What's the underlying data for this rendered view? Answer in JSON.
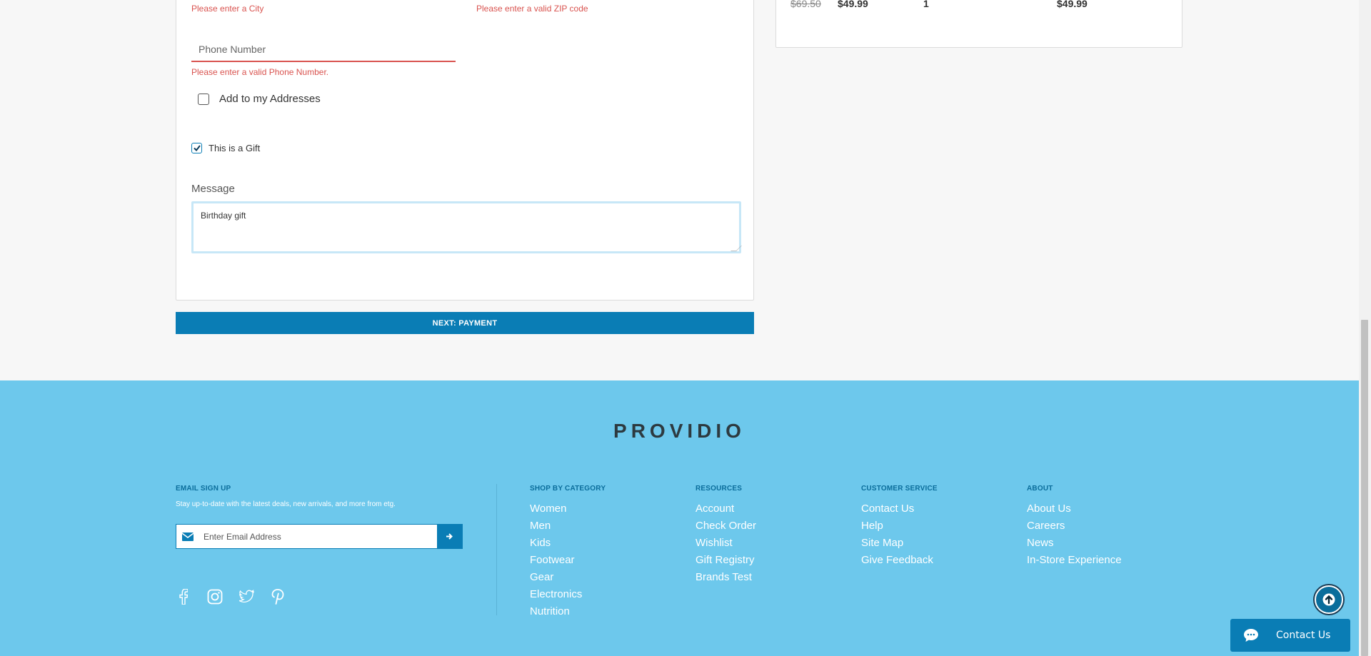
{
  "form": {
    "city_error": "Please enter a City",
    "zip_error": "Please enter a valid ZIP code",
    "phone_placeholder": "Phone Number",
    "phone_error": "Please enter a valid Phone Number.",
    "add_address_label": "Add to my Addresses",
    "add_address_checked": false,
    "gift_label": "This is a Gift",
    "gift_checked": true,
    "message_label": "Message",
    "message_value": "Birthday gift",
    "next_button": "NEXT: PAYMENT"
  },
  "summary": {
    "original_price": "$69.50",
    "sale_price": "$49.99",
    "quantity": "1",
    "total": "$49.99"
  },
  "footer": {
    "brand": "PROVIDIO",
    "email_signup": {
      "title": "EMAIL SIGN UP",
      "subtitle": "Stay up-to-date with the latest deals, new arrivals, and more from etg.",
      "placeholder": "Enter Email Address"
    },
    "social_icons": [
      "facebook-icon",
      "instagram-icon",
      "twitter-icon",
      "pinterest-icon"
    ],
    "columns": [
      {
        "title": "SHOP BY CATEGORY",
        "links": [
          "Women",
          "Men",
          "Kids",
          "Footwear",
          "Gear",
          "Electronics",
          "Nutrition"
        ]
      },
      {
        "title": "RESOURCES",
        "links": [
          "Account",
          "Check Order",
          "Wishlist",
          "Gift Registry",
          "Brands Test"
        ]
      },
      {
        "title": "CUSTOMER SERVICE",
        "links": [
          "Contact Us",
          "Help",
          "Site Map",
          "Give Feedback"
        ]
      },
      {
        "title": "ABOUT",
        "links": [
          "About Us",
          "Careers",
          "News",
          "In-Store Experience"
        ]
      }
    ]
  },
  "chat": {
    "label": "Contact Us"
  },
  "colors": {
    "primary": "#0a7db5",
    "footer_bg": "#6dc8ec",
    "error": "#d9534f",
    "section_title": "#0a6d9b"
  }
}
